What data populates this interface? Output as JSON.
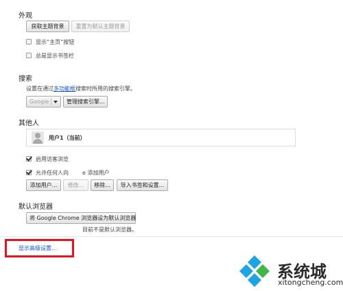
{
  "appearance": {
    "title": "外观",
    "get_theme_button": "获取主题背景",
    "reset_theme_button": "重置为默认主题背景",
    "show_home_label": "显示“主页”按钮",
    "show_bookmarks_label": "总是显示书签栏"
  },
  "search": {
    "title": "搜索",
    "description_prefix": "设置在通过",
    "description_link": "多功能框",
    "description_suffix": "搜索时所用的搜索引擎。",
    "engine_value": "Google",
    "manage_button": "管理搜索引擎..."
  },
  "people": {
    "title": "其他人",
    "user_name": "用户1（当前）",
    "guest_label": "启用访客浏览",
    "anyone_label_a": "允许任何人向",
    "anyone_label_b": "e 添加用户",
    "add_user_button": "添加用户...",
    "edit_button": "修改...",
    "remove_button": "移除...",
    "import_button": "导入书签和设置..."
  },
  "default_browser": {
    "title": "默认浏览器",
    "set_default_button": "将 Google Chrome 浏览器设为默认浏览器",
    "status_text": "目前不是默认浏览器。"
  },
  "advanced": {
    "link_label": "显示高级设置..."
  },
  "watermark": {
    "brand": "系统城",
    "url": "xitongcheng.com"
  },
  "colors": {
    "highlight": "#e8131e",
    "link": "#1155cc",
    "logo_blue": "#1ea4e4",
    "logo_green": "#3fb649"
  }
}
